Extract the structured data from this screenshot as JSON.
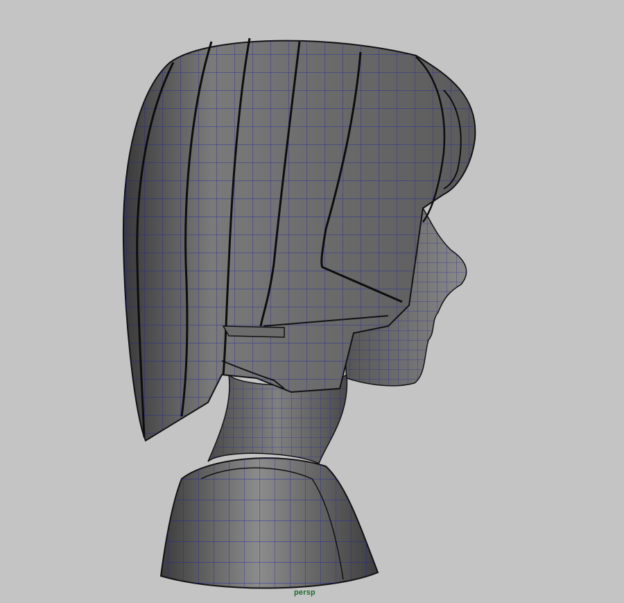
{
  "viewport": {
    "camera": "persp",
    "background": "#c4c4c4",
    "wireframe_color": "#1e1ea8",
    "label_color": "#1d6b2e"
  },
  "model": {
    "icon": "sculpted-head-bust-icon",
    "parts": [
      "hair",
      "face",
      "neck",
      "torso"
    ]
  }
}
